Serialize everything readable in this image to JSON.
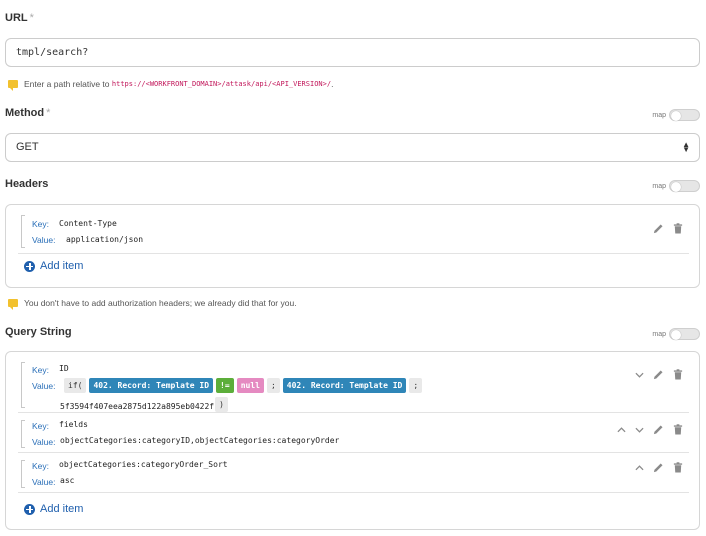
{
  "url": {
    "label": "URL",
    "required_mark": "*",
    "value": "tmpl/search?",
    "hint_prefix": "Enter a path relative to",
    "hint_code": "https://<WORKFRONT_DOMAIN>/attask/api/<API_VERSION>/",
    "hint_suffix": "."
  },
  "method": {
    "label": "Method",
    "required_mark": "*",
    "value": "GET",
    "map_label": "map"
  },
  "headers": {
    "label": "Headers",
    "map_label": "map",
    "items": [
      {
        "key_label": "Key:",
        "key": "Content-Type",
        "value_label": "Value:",
        "value": "application/json"
      }
    ],
    "add_item": "Add item",
    "hint": "You don't have to add authorization headers; we already did that for you."
  },
  "query_string": {
    "label": "Query String",
    "map_label": "map",
    "items": [
      {
        "key_label": "Key:",
        "key": "ID",
        "value_label": "Value:",
        "value_tokens": [
          {
            "text": "if(",
            "style": "plain"
          },
          {
            "text": "402. Record: Template ID",
            "style": "blue"
          },
          {
            "text": "!=",
            "style": "green"
          },
          {
            "text": "null",
            "style": "pink"
          },
          {
            "text": ";",
            "style": "plain"
          },
          {
            "text": "402. Record: Template ID",
            "style": "blue"
          },
          {
            "text": ";",
            "style": "plain"
          }
        ],
        "value_line2": "5f3594f407eea2875d122a895eb0422f",
        "value_close": ")"
      },
      {
        "key_label": "Key:",
        "key": "fields",
        "value_label": "Value:",
        "value": "objectCategories:categoryID,objectCategories:categoryOrder"
      },
      {
        "key_label": "Key:",
        "key": "objectCategories:categoryOrder_Sort",
        "value_label": "Value:",
        "value": "asc"
      }
    ],
    "add_item": "Add item"
  },
  "colors": {
    "link_blue": "#1f5fad",
    "pill_blue": "#2f86b8",
    "pill_green": "#5cae3a",
    "pill_pink": "#e58ac1",
    "hint_yellow": "#f2c12e"
  }
}
